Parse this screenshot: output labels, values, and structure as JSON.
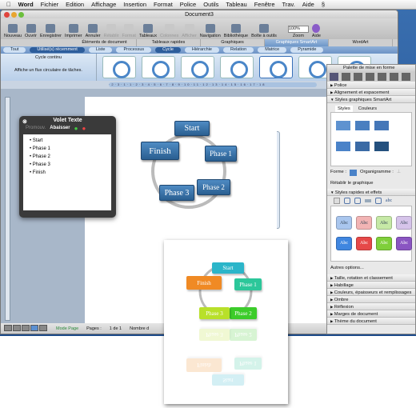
{
  "menubar": {
    "items": [
      "Word",
      "Fichier",
      "Edition",
      "Affichage",
      "Insertion",
      "Format",
      "Police",
      "Outils",
      "Tableau",
      "Fenêtre",
      "Trav.",
      "Aide"
    ]
  },
  "window": {
    "title": "Document3"
  },
  "toolbar": {
    "buttons": [
      {
        "label": "Nouveau",
        "enabled": true
      },
      {
        "label": "Ouvrir",
        "enabled": true
      },
      {
        "label": "Enregistrer",
        "enabled": true
      },
      {
        "label": "Imprimer",
        "enabled": true
      },
      {
        "label": "Annuler",
        "enabled": true
      },
      {
        "label": "Rétablir",
        "enabled": false
      },
      {
        "label": "Format",
        "enabled": false
      },
      {
        "label": "Tableaux",
        "enabled": true
      },
      {
        "label": "Colonnes",
        "enabled": false
      },
      {
        "label": "Afficher",
        "enabled": false
      },
      {
        "label": "Navigation",
        "enabled": true
      },
      {
        "label": "Bibliothèque",
        "enabled": true
      },
      {
        "label": "Boîte à outils",
        "enabled": true
      }
    ],
    "zoom_value": "100%",
    "zoom_label": "Zoom",
    "help_label": "Aide"
  },
  "element_tabs": [
    "Éléments de document",
    "Tableaux rapides",
    "Graphiques",
    "Graphiques SmartArt",
    "WordArt"
  ],
  "element_tabs_active": "Graphiques SmartArt",
  "gallery_categories": [
    "Tout",
    "Utilisé(s) récemment",
    "Liste",
    "Processus",
    "Cycle",
    "Hiérarchie",
    "Relation",
    "Matrice",
    "Pyramide"
  ],
  "gallery_active": [
    "Utilisé(s) récemment",
    "Cycle"
  ],
  "gallery": {
    "name": "Cycle continu",
    "description": "Affiche un flux circulaire de tâches."
  },
  "ruler": {
    "ticks": "·2·3·1·1·2·3·4·5·6·7·8·9·10·11·12·13·14·15·16·17·18"
  },
  "diagram": {
    "nodes": [
      "Start",
      "Phase 1",
      "Phase 2",
      "Phase 3",
      "Finish"
    ]
  },
  "text_pane": {
    "title": "Volet Texte",
    "promote": "Promouv.",
    "demote": "Abaisser",
    "items": [
      "Start",
      "Phase 1",
      "Phase 2",
      "Phase 3",
      "Finish"
    ]
  },
  "status": {
    "mode": "Mode Page",
    "pages_label": "Pages :",
    "pages_value": "1 de 1",
    "words": "Nombre d"
  },
  "palette": {
    "title": "Palette de mise en forme",
    "sections_top": [
      "Police",
      "Alignement et espacement",
      "Styles graphiques SmartArt"
    ],
    "tabs": [
      "Styles",
      "Couleurs"
    ],
    "forme_label": "Forme :",
    "organigramme_label": "Organigramme :",
    "reset": "Rétablir le graphique",
    "quick_styles": "Styles rapides et effets",
    "abc": "Abc",
    "abc_text": "abc",
    "more_options": "Autres options...",
    "sections_bottom": [
      "Taille, rotation et classement",
      "Habillage",
      "Couleurs, épaisseurs et remplissages",
      "Ombre",
      "Réflexion",
      "Marges de document",
      "Thème du document"
    ],
    "swatch_colors": [
      "#a9c6ee",
      "#f2b4b4",
      "#c6e9a6",
      "#d6c4ea",
      "#3f86e0",
      "#e64848",
      "#7fcf3a",
      "#8a55c2"
    ]
  },
  "inset_nodes": [
    {
      "label": "Start",
      "color": "#2bb5c9"
    },
    {
      "label": "Phase 1",
      "color": "#2cc79a"
    },
    {
      "label": "Phase 2",
      "color": "#3ccc2a"
    },
    {
      "label": "Phase 3",
      "color": "#b8e02a"
    },
    {
      "label": "Finish",
      "color": "#f08a24"
    }
  ]
}
